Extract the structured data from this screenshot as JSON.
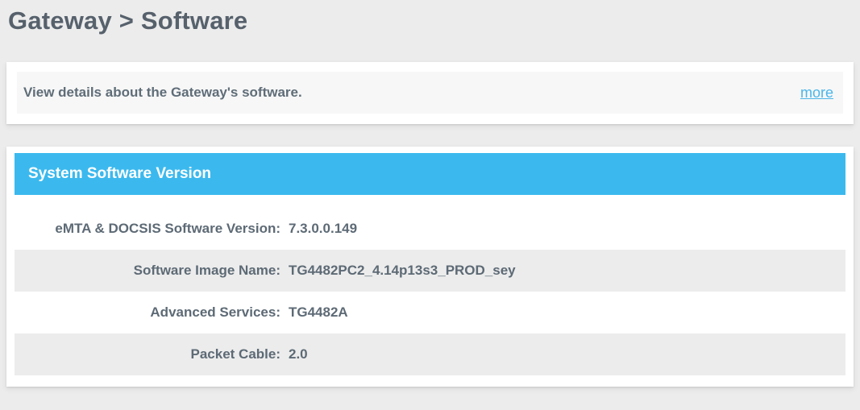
{
  "page": {
    "title": "Gateway > Software"
  },
  "description_card": {
    "text": "View details about the Gateway's software.",
    "more_link_label": "more"
  },
  "software_section": {
    "header": "System Software Version",
    "rows": [
      {
        "label": "eMTA & DOCSIS Software Version:",
        "value": "7.3.0.0.149"
      },
      {
        "label": "Software Image Name:",
        "value": "TG4482PC2_4.14p13s3_PROD_sey"
      },
      {
        "label": "Advanced Services:",
        "value": "TG4482A"
      },
      {
        "label": "Packet Cable:",
        "value": "2.0"
      }
    ]
  },
  "colors": {
    "accent_blue": "#3bb9ee",
    "link_blue": "#4ab7e9",
    "heading_text": "#56616c",
    "body_text": "#5d6a75",
    "page_background": "#ececec",
    "row_alt_background": "#ececec",
    "panel_background": "#f7f7f7",
    "card_background": "#ffffff"
  }
}
